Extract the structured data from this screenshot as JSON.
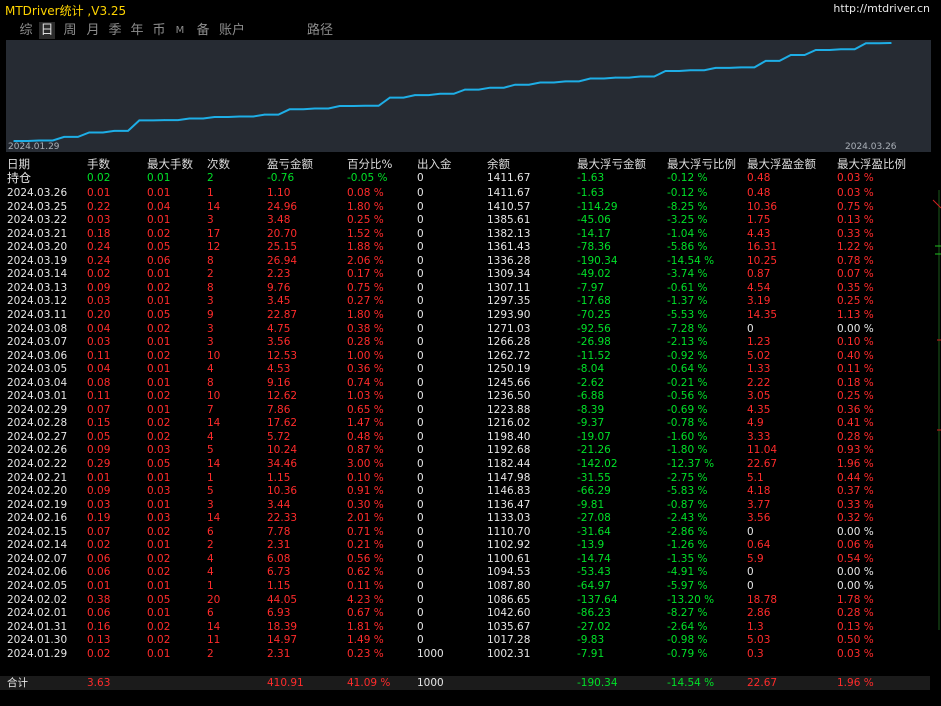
{
  "window": {
    "title": "MTDriver统计 ,V3.25",
    "url": "http://mtdriver.cn"
  },
  "tabs": [
    {
      "label": "综",
      "active": false
    },
    {
      "label": "日",
      "active": true
    },
    {
      "label": "周",
      "active": false
    },
    {
      "label": "月",
      "active": false
    },
    {
      "label": "季",
      "active": false
    },
    {
      "label": "年",
      "active": false
    },
    {
      "label": "币",
      "active": false
    },
    {
      "label": "M",
      "active": false
    },
    {
      "label": "备",
      "active": false
    },
    {
      "label": "账户",
      "active": false
    },
    {
      "label": "路径",
      "active": false
    }
  ],
  "chart_data": {
    "type": "line",
    "x_start_label": "2024.01.29",
    "x_end_label": "2024.03.26",
    "line_color": "#1eaee6",
    "series": [
      {
        "values": [
          1000,
          1002.31,
          1017.28,
          1035.67,
          1042.6,
          1086.65,
          1087.8,
          1094.53,
          1100.61,
          1102.92,
          1110.7,
          1133.03,
          1136.47,
          1146.83,
          1147.98,
          1182.44,
          1192.68,
          1198.4,
          1216.02,
          1223.88,
          1236.5,
          1245.66,
          1250.19,
          1262.72,
          1266.28,
          1271.03,
          1293.9,
          1297.35,
          1307.11,
          1309.34,
          1336.28,
          1361.43,
          1382.13,
          1385.61,
          1410.57,
          1411.67
        ]
      }
    ]
  },
  "table": {
    "headers": [
      "日期",
      "手数",
      "最大手数",
      "次数",
      "盈亏金额",
      "百分比%",
      "出入金",
      "余额",
      "最大浮亏金额",
      "最大浮亏比例",
      "最大浮盈金额",
      "最大浮盈比例"
    ],
    "position": [
      "持仓",
      "0.02",
      "0.01",
      "2",
      "-0.76",
      "-0.05 %",
      "0",
      "1411.67",
      "-1.63",
      "-0.12 %",
      "0.48",
      "0.03 %"
    ],
    "rows": [
      [
        "2024.03.26",
        "0.01",
        "0.01",
        "1",
        "1.10",
        "0.08 %",
        "0",
        "1411.67",
        "-1.63",
        "-0.12 %",
        "0.48",
        "0.03 %"
      ],
      [
        "2024.03.25",
        "0.22",
        "0.04",
        "14",
        "24.96",
        "1.80 %",
        "0",
        "1410.57",
        "-114.29",
        "-8.25 %",
        "10.36",
        "0.75 %"
      ],
      [
        "2024.03.22",
        "0.03",
        "0.01",
        "3",
        "3.48",
        "0.25 %",
        "0",
        "1385.61",
        "-45.06",
        "-3.25 %",
        "1.75",
        "0.13 %"
      ],
      [
        "2024.03.21",
        "0.18",
        "0.02",
        "17",
        "20.70",
        "1.52 %",
        "0",
        "1382.13",
        "-14.17",
        "-1.04 %",
        "4.43",
        "0.33 %"
      ],
      [
        "2024.03.20",
        "0.24",
        "0.05",
        "12",
        "25.15",
        "1.88 %",
        "0",
        "1361.43",
        "-78.36",
        "-5.86 %",
        "16.31",
        "1.22 %"
      ],
      [
        "2024.03.19",
        "0.24",
        "0.06",
        "8",
        "26.94",
        "2.06 %",
        "0",
        "1336.28",
        "-190.34",
        "-14.54 %",
        "10.25",
        "0.78 %"
      ],
      [
        "2024.03.14",
        "0.02",
        "0.01",
        "2",
        "2.23",
        "0.17 %",
        "0",
        "1309.34",
        "-49.02",
        "-3.74 %",
        "0.87",
        "0.07 %"
      ],
      [
        "2024.03.13",
        "0.09",
        "0.02",
        "8",
        "9.76",
        "0.75 %",
        "0",
        "1307.11",
        "-7.97",
        "-0.61 %",
        "4.54",
        "0.35 %"
      ],
      [
        "2024.03.12",
        "0.03",
        "0.01",
        "3",
        "3.45",
        "0.27 %",
        "0",
        "1297.35",
        "-17.68",
        "-1.37 %",
        "3.19",
        "0.25 %"
      ],
      [
        "2024.03.11",
        "0.20",
        "0.05",
        "9",
        "22.87",
        "1.80 %",
        "0",
        "1293.90",
        "-70.25",
        "-5.53 %",
        "14.35",
        "1.13 %"
      ],
      [
        "2024.03.08",
        "0.04",
        "0.02",
        "3",
        "4.75",
        "0.38 %",
        "0",
        "1271.03",
        "-92.56",
        "-7.28 %",
        "0",
        "0.00 %"
      ],
      [
        "2024.03.07",
        "0.03",
        "0.01",
        "3",
        "3.56",
        "0.28 %",
        "0",
        "1266.28",
        "-26.98",
        "-2.13 %",
        "1.23",
        "0.10 %"
      ],
      [
        "2024.03.06",
        "0.11",
        "0.02",
        "10",
        "12.53",
        "1.00 %",
        "0",
        "1262.72",
        "-11.52",
        "-0.92 %",
        "5.02",
        "0.40 %"
      ],
      [
        "2024.03.05",
        "0.04",
        "0.01",
        "4",
        "4.53",
        "0.36 %",
        "0",
        "1250.19",
        "-8.04",
        "-0.64 %",
        "1.33",
        "0.11 %"
      ],
      [
        "2024.03.04",
        "0.08",
        "0.01",
        "8",
        "9.16",
        "0.74 %",
        "0",
        "1245.66",
        "-2.62",
        "-0.21 %",
        "2.22",
        "0.18 %"
      ],
      [
        "2024.03.01",
        "0.11",
        "0.02",
        "10",
        "12.62",
        "1.03 %",
        "0",
        "1236.50",
        "-6.88",
        "-0.56 %",
        "3.05",
        "0.25 %"
      ],
      [
        "2024.02.29",
        "0.07",
        "0.01",
        "7",
        "7.86",
        "0.65 %",
        "0",
        "1223.88",
        "-8.39",
        "-0.69 %",
        "4.35",
        "0.36 %"
      ],
      [
        "2024.02.28",
        "0.15",
        "0.02",
        "14",
        "17.62",
        "1.47 %",
        "0",
        "1216.02",
        "-9.37",
        "-0.78 %",
        "4.9",
        "0.41 %"
      ],
      [
        "2024.02.27",
        "0.05",
        "0.02",
        "4",
        "5.72",
        "0.48 %",
        "0",
        "1198.40",
        "-19.07",
        "-1.60 %",
        "3.33",
        "0.28 %"
      ],
      [
        "2024.02.26",
        "0.09",
        "0.03",
        "5",
        "10.24",
        "0.87 %",
        "0",
        "1192.68",
        "-21.26",
        "-1.80 %",
        "11.04",
        "0.93 %"
      ],
      [
        "2024.02.22",
        "0.29",
        "0.05",
        "14",
        "34.46",
        "3.00 %",
        "0",
        "1182.44",
        "-142.02",
        "-12.37 %",
        "22.67",
        "1.96 %"
      ],
      [
        "2024.02.21",
        "0.01",
        "0.01",
        "1",
        "1.15",
        "0.10 %",
        "0",
        "1147.98",
        "-31.55",
        "-2.75 %",
        "5.1",
        "0.44 %"
      ],
      [
        "2024.02.20",
        "0.09",
        "0.03",
        "5",
        "10.36",
        "0.91 %",
        "0",
        "1146.83",
        "-66.29",
        "-5.83 %",
        "4.18",
        "0.37 %"
      ],
      [
        "2024.02.19",
        "0.03",
        "0.01",
        "3",
        "3.44",
        "0.30 %",
        "0",
        "1136.47",
        "-9.81",
        "-0.87 %",
        "3.77",
        "0.33 %"
      ],
      [
        "2024.02.16",
        "0.19",
        "0.03",
        "14",
        "22.33",
        "2.01 %",
        "0",
        "1133.03",
        "-27.08",
        "-2.43 %",
        "3.56",
        "0.32 %"
      ],
      [
        "2024.02.15",
        "0.07",
        "0.02",
        "6",
        "7.78",
        "0.71 %",
        "0",
        "1110.70",
        "-31.64",
        "-2.86 %",
        "0",
        "0.00 %"
      ],
      [
        "2024.02.14",
        "0.02",
        "0.01",
        "2",
        "2.31",
        "0.21 %",
        "0",
        "1102.92",
        "-13.9",
        "-1.26 %",
        "0.64",
        "0.06 %"
      ],
      [
        "2024.02.07",
        "0.06",
        "0.02",
        "4",
        "6.08",
        "0.56 %",
        "0",
        "1100.61",
        "-14.74",
        "-1.35 %",
        "5.9",
        "0.54 %"
      ],
      [
        "2024.02.06",
        "0.06",
        "0.02",
        "4",
        "6.73",
        "0.62 %",
        "0",
        "1094.53",
        "-53.43",
        "-4.91 %",
        "0",
        "0.00 %"
      ],
      [
        "2024.02.05",
        "0.01",
        "0.01",
        "1",
        "1.15",
        "0.11 %",
        "0",
        "1087.80",
        "-64.97",
        "-5.97 %",
        "0",
        "0.00 %"
      ],
      [
        "2024.02.02",
        "0.38",
        "0.05",
        "20",
        "44.05",
        "4.23 %",
        "0",
        "1086.65",
        "-137.64",
        "-13.20 %",
        "18.78",
        "1.78 %"
      ],
      [
        "2024.02.01",
        "0.06",
        "0.01",
        "6",
        "6.93",
        "0.67 %",
        "0",
        "1042.60",
        "-86.23",
        "-8.27 %",
        "2.86",
        "0.28 %"
      ],
      [
        "2024.01.31",
        "0.16",
        "0.02",
        "14",
        "18.39",
        "1.81 %",
        "0",
        "1035.67",
        "-27.02",
        "-2.64 %",
        "1.3",
        "0.13 %"
      ],
      [
        "2024.01.30",
        "0.13",
        "0.02",
        "11",
        "14.97",
        "1.49 %",
        "0",
        "1017.28",
        "-9.83",
        "-0.98 %",
        "5.03",
        "0.50 %"
      ],
      [
        "2024.01.29",
        "0.02",
        "0.01",
        "2",
        "2.31",
        "0.23 %",
        "1000",
        "1002.31",
        "-7.91",
        "-0.79 %",
        "0.3",
        "0.03 %"
      ]
    ],
    "total": [
      "合计",
      "3.63",
      "",
      "",
      "410.91",
      "41.09 %",
      "1000",
      "",
      "-190.34",
      "-14.54 %",
      "22.67",
      "1.96 %"
    ]
  },
  "colors": {
    "background": "#000000",
    "title": "#ffd400",
    "profit": "#ff2b2b",
    "loss": "#00e028",
    "neutral": "#e6e6e6",
    "chart_panel": "#262b33",
    "equity_line": "#1eaee6"
  }
}
